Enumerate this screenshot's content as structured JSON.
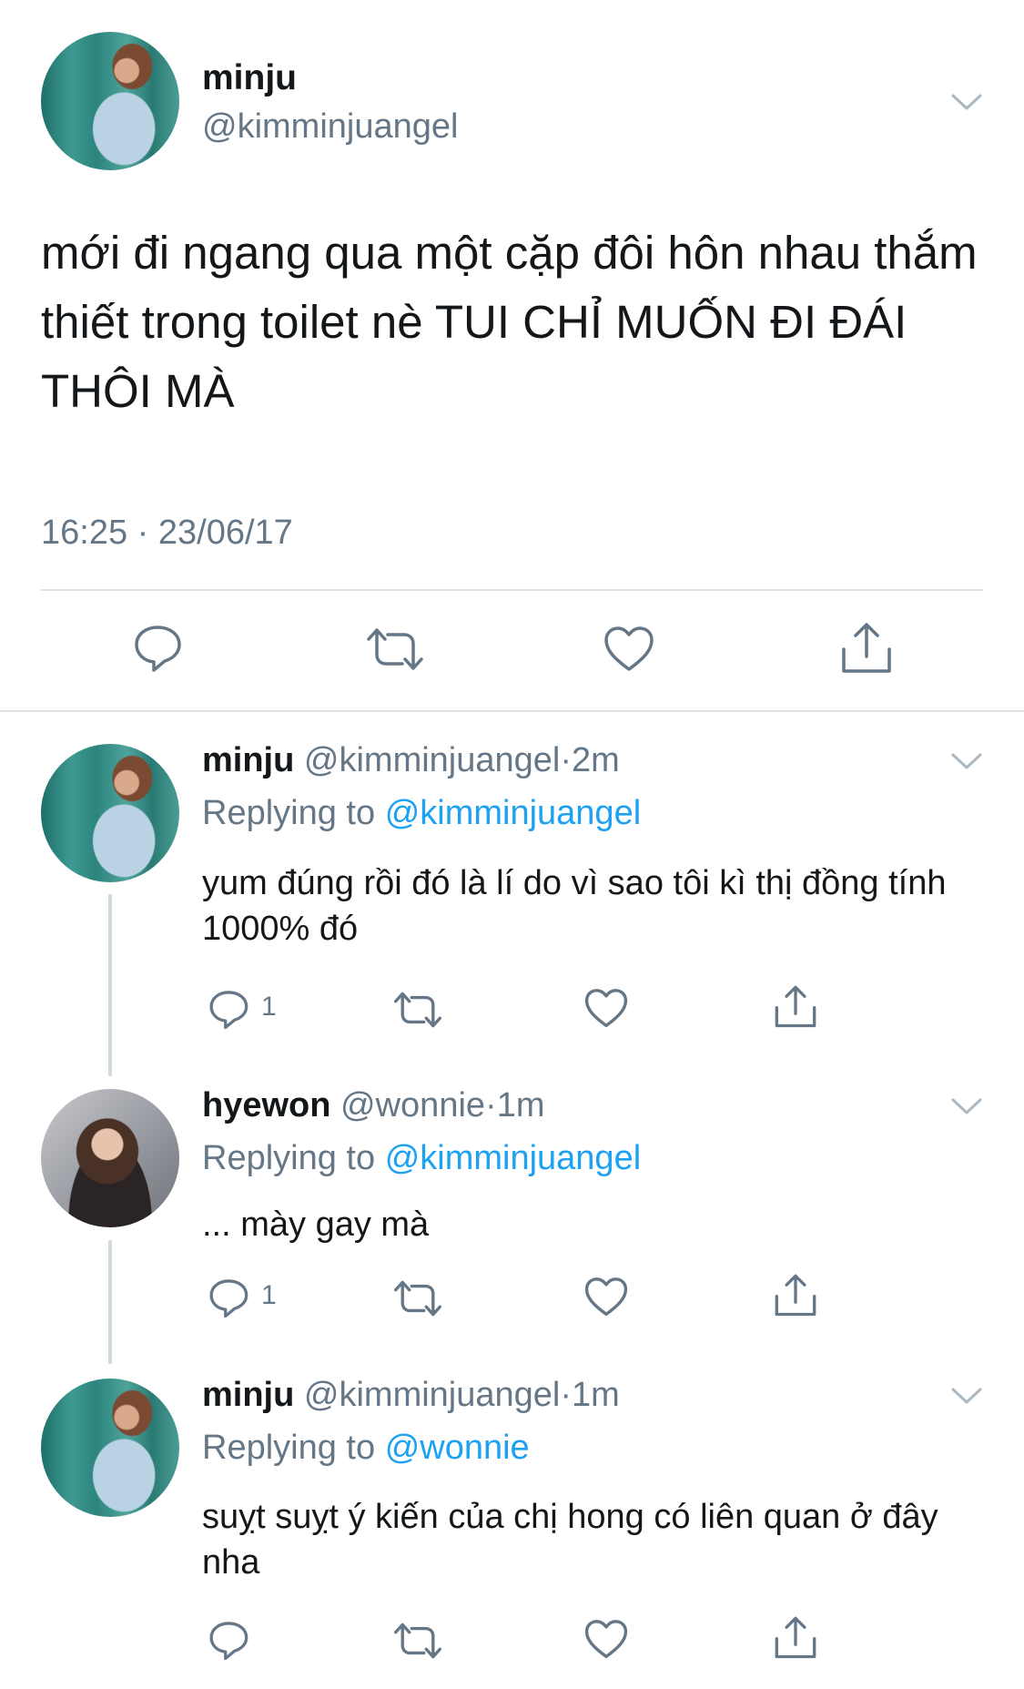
{
  "main_tweet": {
    "name": "minju",
    "handle": "@kimminjuangel",
    "text": "mới đi ngang qua một cặp đôi hôn nhau thắm thiết trong toilet nè TUI CHỈ MUỐN ĐI ĐÁI THÔI MÀ",
    "timestamp": "16:25 · 23/06/17",
    "actions": [
      "reply-icon",
      "retweet-icon",
      "like-icon",
      "share-icon"
    ]
  },
  "replies": [
    {
      "name": "minju",
      "handle": "@kimminjuangel",
      "sep": "·",
      "time": "2m",
      "replying_prefix": "Replying to",
      "replying_to": "@kimminjuangel",
      "text": "yum đúng rồi đó là lí do vì sao tôi kì thị đồng tính 1000% đó",
      "reply_count": "1"
    },
    {
      "name": "hyewon",
      "handle": "@wonnie",
      "sep": "·",
      "time": "1m",
      "replying_prefix": "Replying to",
      "replying_to": "@kimminjuangel",
      "text": "... mày gay mà",
      "reply_count": "1"
    },
    {
      "name": "minju",
      "handle": "@kimminjuangel",
      "sep": "·",
      "time": "1m",
      "replying_prefix": "Replying to",
      "replying_to": "@wonnie",
      "text": "suỵt suỵt ý kiến của chị hong có liên quan ở đây nha",
      "reply_count": ""
    }
  ],
  "colors": {
    "text": "#14171a",
    "secondary": "#657786",
    "link": "#1da1f2",
    "divider": "#dfe3e7"
  }
}
